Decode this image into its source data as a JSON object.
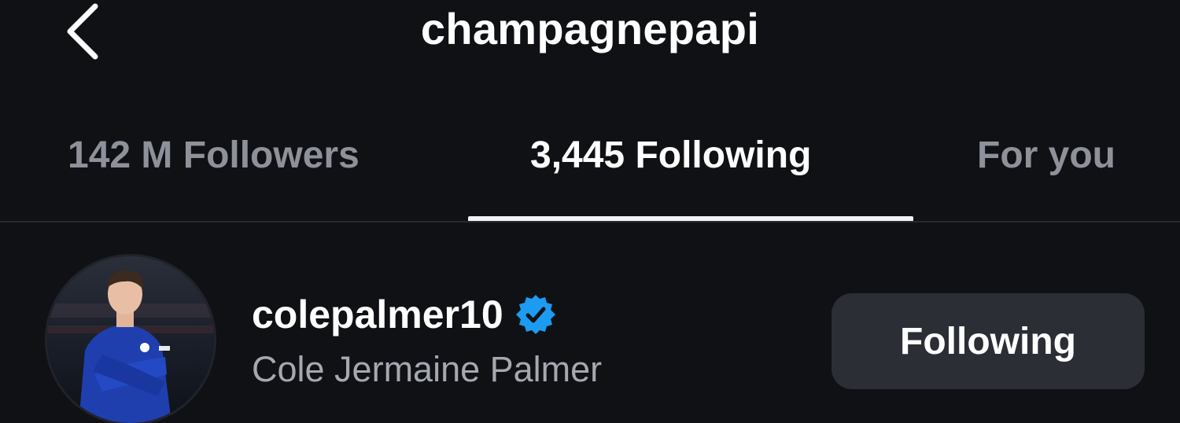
{
  "header": {
    "title": "champagnepapi",
    "back_icon": "chevron-left-icon"
  },
  "tabs": [
    {
      "label": "142 M Followers",
      "active": false
    },
    {
      "label": "3,445 Following",
      "active": true
    },
    {
      "label": "For you",
      "active": false
    }
  ],
  "following_list": [
    {
      "username": "colepalmer10",
      "full_name": "Cole Jermaine Palmer",
      "verified": true,
      "button_label": "Following"
    }
  ],
  "colors": {
    "background": "#0f1115",
    "text_primary": "#ffffff",
    "text_secondary": "#a5a8b0",
    "tab_inactive": "#8e9199",
    "button_bg": "#2b2e35",
    "verified_blue": "#1d9bf0"
  }
}
